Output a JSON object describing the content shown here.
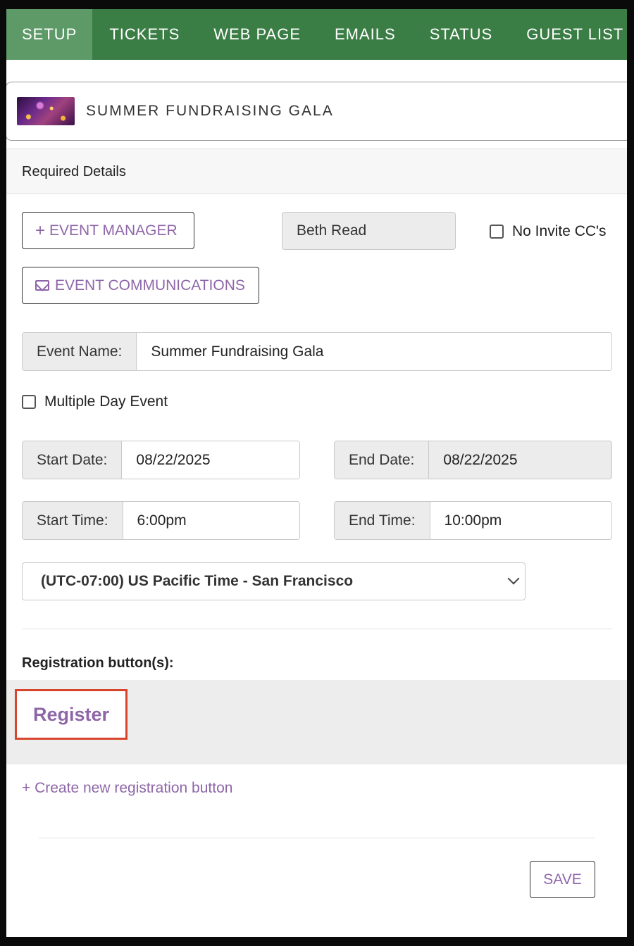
{
  "nav": {
    "tabs": [
      {
        "label": "SETUP",
        "active": true
      },
      {
        "label": "TICKETS"
      },
      {
        "label": "WEB PAGE"
      },
      {
        "label": "EMAILS"
      },
      {
        "label": "STATUS"
      },
      {
        "label": "GUEST LIST"
      }
    ]
  },
  "event": {
    "title": "SUMMER FUNDRAISING GALA"
  },
  "section": {
    "title": "Required Details"
  },
  "manager": {
    "button_label": "EVENT MANAGER",
    "button_icon": "plus-icon",
    "current": "Beth Read",
    "no_invite_cc_label": "No Invite CC's",
    "no_invite_cc_checked": false
  },
  "communications": {
    "button_label": "EVENT COMMUNICATIONS",
    "button_icon": "envelope-icon"
  },
  "event_name": {
    "label": "Event Name:",
    "value": "Summer Fundraising Gala"
  },
  "multi_day": {
    "label": "Multiple Day Event",
    "checked": false
  },
  "dates": {
    "start_label": "Start Date:",
    "start_value": "08/22/2025",
    "end_label": "End Date:",
    "end_value": "08/22/2025"
  },
  "times": {
    "start_label": "Start Time:",
    "start_value": "6:00pm",
    "end_label": "End Time:",
    "end_value": "10:00pm"
  },
  "timezone": {
    "selected": "(UTC-07:00) US Pacific Time - San Francisco"
  },
  "registration": {
    "label": "Registration button(s):",
    "buttons": [
      "Register"
    ],
    "create_link": "+ Create new registration button"
  },
  "footer": {
    "save_label": "SAVE"
  },
  "colors": {
    "nav_bg": "#3a7d45",
    "nav_active": "#5d9a67",
    "accent_purple": "#8e66a8",
    "highlight_red": "#d6452c"
  }
}
